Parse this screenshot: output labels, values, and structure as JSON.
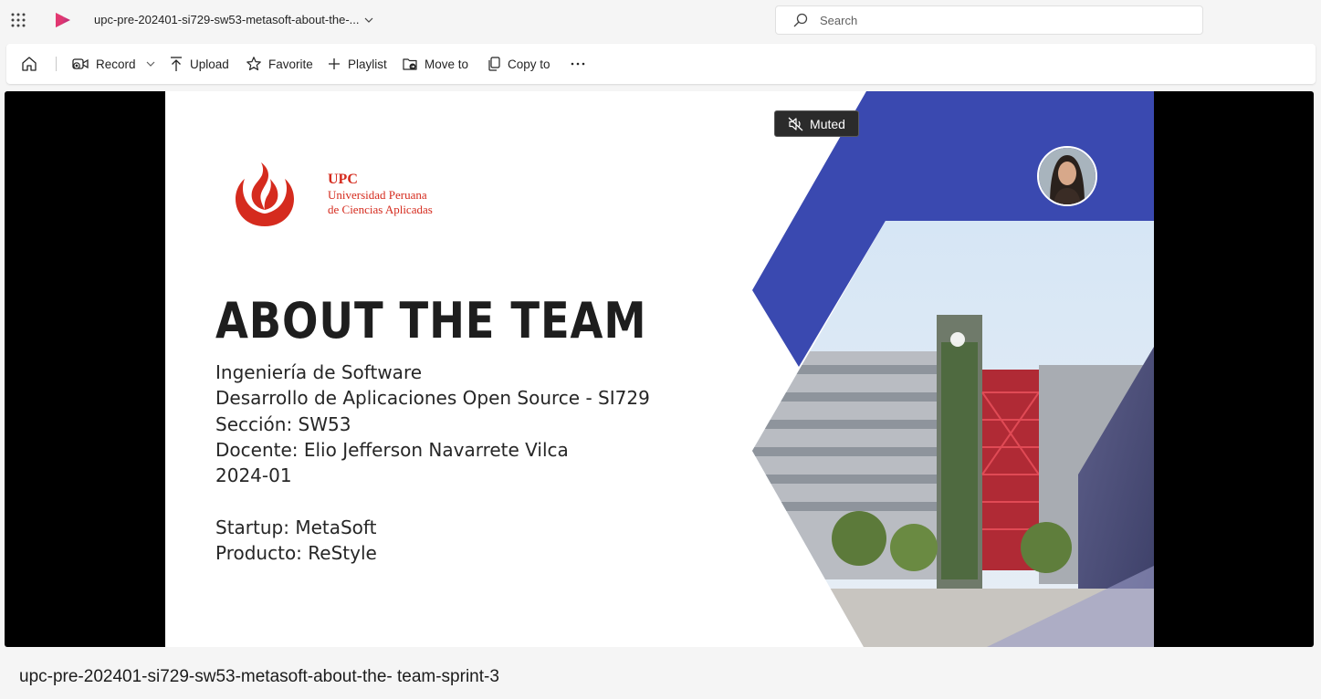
{
  "topbar": {
    "file_title": "upc-pre-202401-si729-sw53-metasoft-about-the-...",
    "search_placeholder": "Search"
  },
  "commands": {
    "record": "Record",
    "upload": "Upload",
    "favorite": "Favorite",
    "playlist": "Playlist",
    "move_to": "Move to",
    "copy_to": "Copy to"
  },
  "player": {
    "muted_label": "Muted"
  },
  "slide": {
    "logo_abbr": "UPC",
    "logo_line1": "Universidad Peruana",
    "logo_line2": "de Ciencias Aplicadas",
    "heading": "ABOUT THE TEAM",
    "lines": [
      "Ingeniería de Software",
      "Desarrollo de Aplicaciones Open Source - SI729",
      "Sección: SW53",
      "Docente: Elio Jefferson Navarrete Vilca",
      "2024-01",
      " ",
      "Startup: MetaSoft",
      "Producto: ReStyle"
    ]
  },
  "video_title": "upc-pre-202401-si729-sw53-metasoft-about-the- team-sprint-3",
  "colors": {
    "accent_blue": "#3a49b0",
    "upc_red": "#d52b1e",
    "stream_pink": "#e2356f"
  }
}
